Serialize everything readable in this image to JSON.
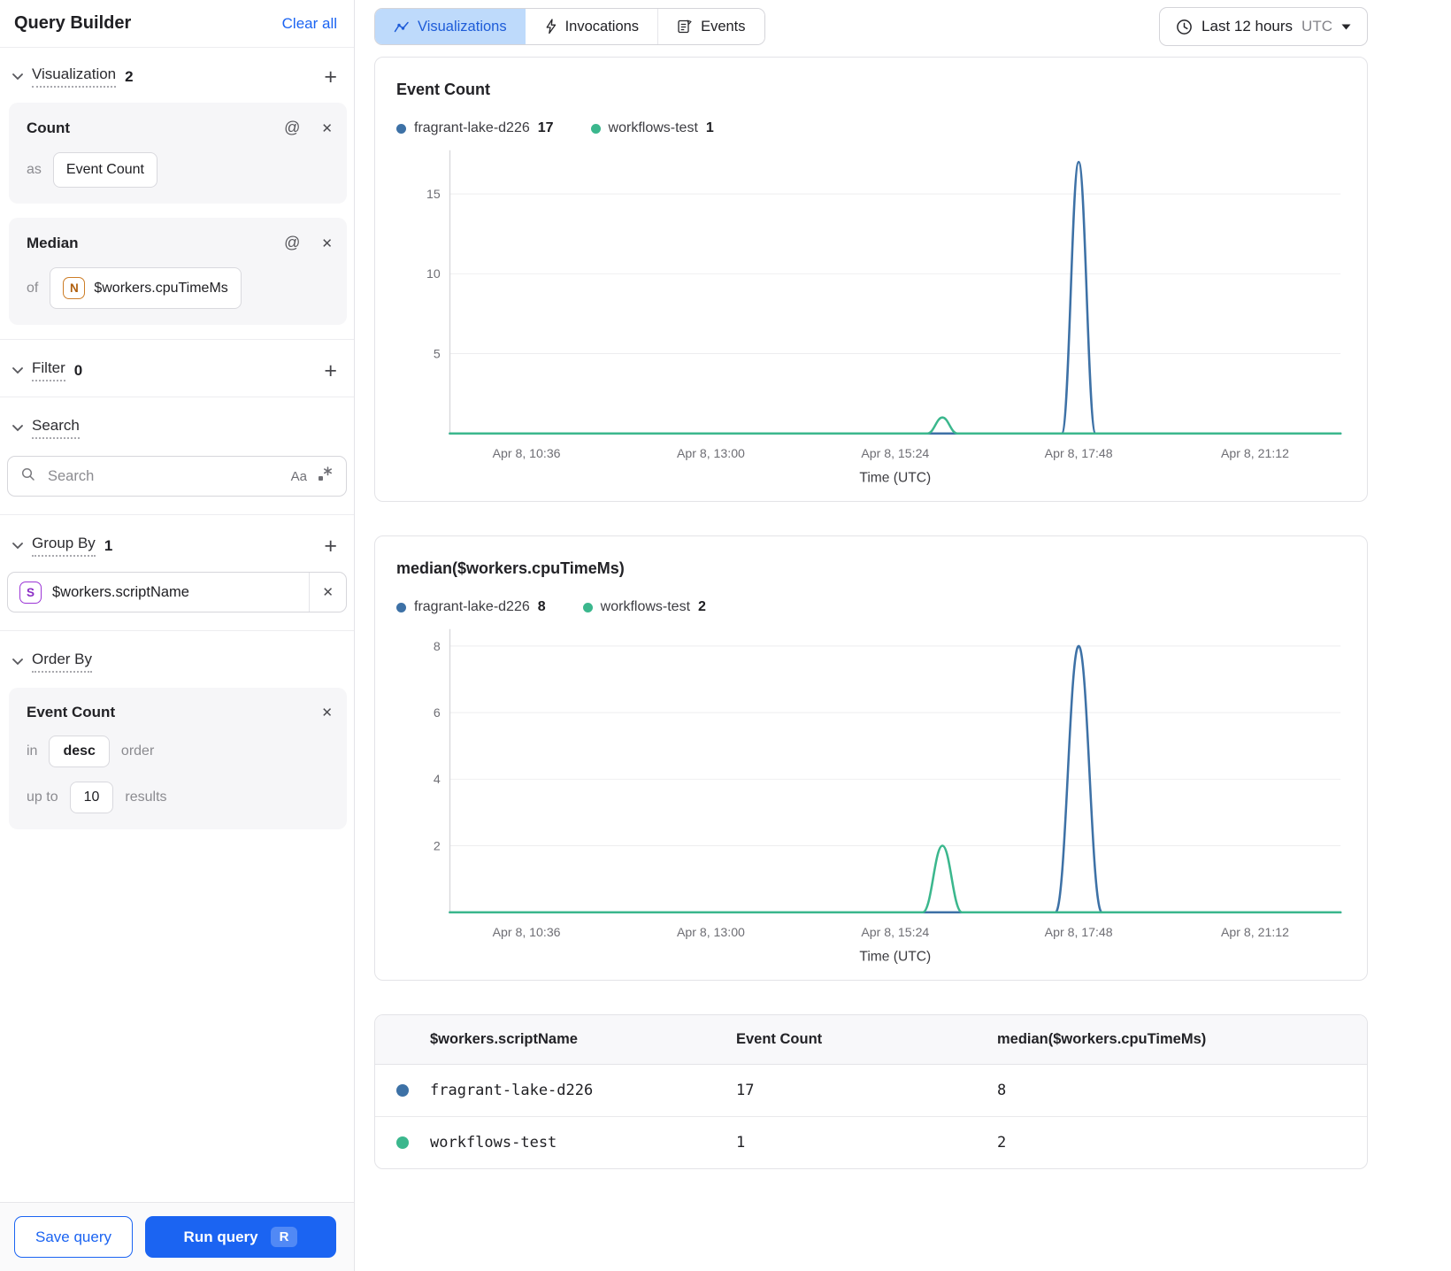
{
  "sidebar": {
    "title": "Query Builder",
    "clear_all": "Clear all",
    "visualization": {
      "label": "Visualization",
      "count": "2",
      "cards": [
        {
          "title": "Count",
          "prefix": "as",
          "value": "Event Count"
        },
        {
          "title": "Median",
          "prefix": "of",
          "badge": "N",
          "value": "$workers.cpuTimeMs"
        }
      ]
    },
    "filter": {
      "label": "Filter",
      "count": "0"
    },
    "search": {
      "label": "Search",
      "placeholder": "Search",
      "case_icon": "Aa"
    },
    "group_by": {
      "label": "Group By",
      "count": "1",
      "badge": "S",
      "value": "$workers.scriptName"
    },
    "order_by": {
      "label": "Order By",
      "card": {
        "title": "Event Count",
        "in_label": "in",
        "order_value": "desc",
        "order_suffix": "order",
        "up_to_label": "up to",
        "limit_value": "10",
        "results_label": "results"
      }
    },
    "footer": {
      "save": "Save query",
      "run": "Run query",
      "shortcut": "R"
    }
  },
  "topbar": {
    "tabs": [
      {
        "label": "Visualizations",
        "active": true
      },
      {
        "label": "Invocations",
        "active": false
      },
      {
        "label": "Events",
        "active": false
      }
    ],
    "time_range": {
      "label": "Last 12 hours",
      "zone": "UTC"
    }
  },
  "colors": {
    "accent": "#1b64f2",
    "series_blue": "#3d71a6",
    "series_green": "#3bb78d"
  },
  "chart_data": [
    {
      "type": "line",
      "title": "Event Count",
      "xlabel": "Time (UTC)",
      "ylabel": "",
      "ylim": [
        0,
        17.3
      ],
      "yticks": [
        5,
        10,
        15
      ],
      "grid": true,
      "legend_position": "top",
      "xticks": [
        {
          "label": "Apr 8, 10:36",
          "pos": 0.086
        },
        {
          "label": "Apr 8, 13:00",
          "pos": 0.293
        },
        {
          "label": "Apr 8, 15:24",
          "pos": 0.5
        },
        {
          "label": "Apr 8, 17:48",
          "pos": 0.706
        },
        {
          "label": "Apr 8, 21:12",
          "pos": 0.904
        }
      ],
      "series": [
        {
          "name": "fragrant-lake-d226",
          "legend_value": "17",
          "color": "#3d71a6",
          "baseline": 0,
          "peak": {
            "center": 0.706,
            "halfwidth": 0.019,
            "value": 17
          }
        },
        {
          "name": "workflows-test",
          "legend_value": "1",
          "color": "#3bb78d",
          "baseline": 0,
          "peak": {
            "center": 0.553,
            "halfwidth": 0.017,
            "value": 1
          }
        }
      ]
    },
    {
      "type": "line",
      "title": "median($workers.cpuTimeMs)",
      "xlabel": "Time (UTC)",
      "ylabel": "",
      "ylim": [
        0,
        8.3
      ],
      "yticks": [
        2,
        4,
        6,
        8
      ],
      "grid": true,
      "legend_position": "top",
      "xticks": [
        {
          "label": "Apr 8, 10:36",
          "pos": 0.086
        },
        {
          "label": "Apr 8, 13:00",
          "pos": 0.293
        },
        {
          "label": "Apr 8, 15:24",
          "pos": 0.5
        },
        {
          "label": "Apr 8, 17:48",
          "pos": 0.706
        },
        {
          "label": "Apr 8, 21:12",
          "pos": 0.904
        }
      ],
      "series": [
        {
          "name": "fragrant-lake-d226",
          "legend_value": "8",
          "color": "#3d71a6",
          "baseline": 0,
          "peak": {
            "center": 0.706,
            "halfwidth": 0.026,
            "value": 8
          }
        },
        {
          "name": "workflows-test",
          "legend_value": "2",
          "color": "#3bb78d",
          "baseline": 0,
          "peak": {
            "center": 0.553,
            "halfwidth": 0.022,
            "value": 2
          }
        }
      ]
    }
  ],
  "table": {
    "headers": [
      "$workers.scriptName",
      "Event Count",
      "median($workers.cpuTimeMs)"
    ],
    "rows": [
      {
        "dot": "#3d71a6",
        "name": "fragrant-lake-d226",
        "values": [
          "17",
          "8"
        ]
      },
      {
        "dot": "#3bb78d",
        "name": "workflows-test",
        "values": [
          "1",
          "2"
        ]
      }
    ]
  }
}
